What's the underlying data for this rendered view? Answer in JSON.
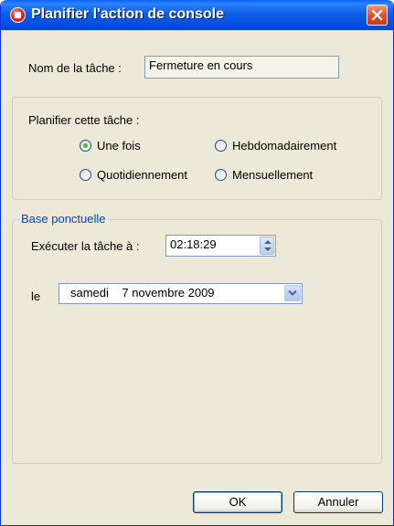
{
  "window": {
    "title": "Planifier l'action de console"
  },
  "task": {
    "label": "Nom de la tâche :",
    "value": "Fermeture en cours"
  },
  "schedule": {
    "label": "Planifier cette tâche :",
    "options": [
      {
        "label": "Une fois",
        "checked": true
      },
      {
        "label": "Hebdomadairement",
        "checked": false
      },
      {
        "label": "Quotidiennement",
        "checked": false
      },
      {
        "label": "Mensuellement",
        "checked": false
      }
    ]
  },
  "base": {
    "legend": "Base ponctuelle",
    "time_label": "Exécuter la tâche à :",
    "time_value": "02:18:29",
    "date_label": "le",
    "date_value": "samedi    7 novembre 2009"
  },
  "buttons": {
    "ok": "OK",
    "cancel": "Annuler"
  },
  "colors": {
    "titlebar": "#0a62f5",
    "window_bg": "#ece9d8",
    "legend": "#0046d5"
  },
  "icons": {
    "app": "red-record-icon",
    "close": "close-icon",
    "spin": "spin-arrows-icon",
    "dropdown": "chevron-down-icon"
  }
}
